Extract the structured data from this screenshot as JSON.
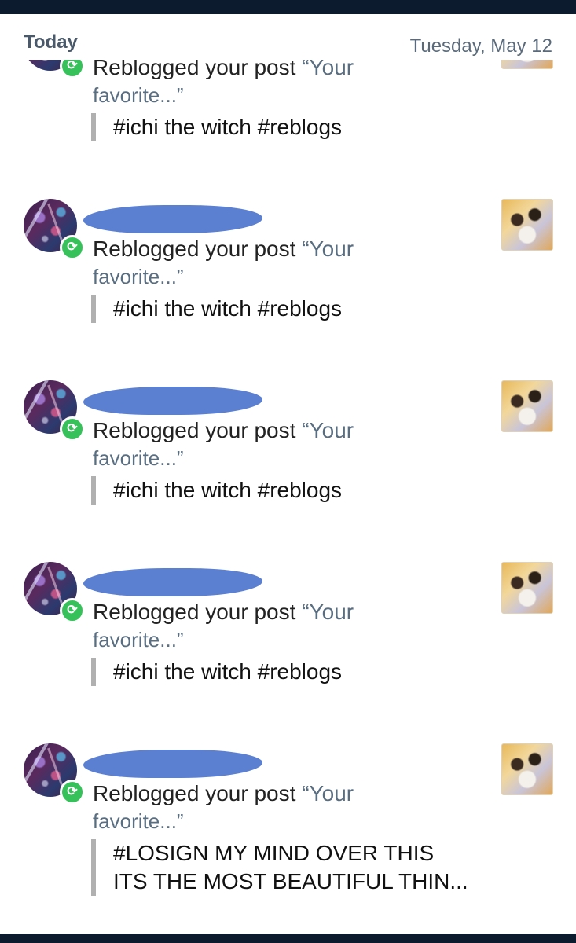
{
  "header": {
    "today_label": "Today",
    "date_label": "Tuesday, May 12"
  },
  "activity": [
    {
      "action": "Reblogged your post",
      "post_title_start": "“Your",
      "post_title_end": "favorite...”",
      "tags": "#ichi the witch #reblogs"
    },
    {
      "action": "Reblogged your post",
      "post_title_start": "“Your",
      "post_title_end": "favorite...”",
      "tags": "#ichi the witch #reblogs"
    },
    {
      "action": "Reblogged your post",
      "post_title_start": "“Your",
      "post_title_end": "favorite...”",
      "tags": "#ichi the witch #reblogs"
    },
    {
      "action": "Reblogged your post",
      "post_title_start": "“Your",
      "post_title_end": "favorite...”",
      "tags": "#ichi the witch #reblogs"
    },
    {
      "action": "Reblogged your post",
      "post_title_start": "“Your",
      "post_title_end": "favorite...”",
      "tags_line1": "#LOSIGN MY MIND OVER THIS",
      "tags_line2": "ITS THE MOST BEAUTIFUL THIN..."
    }
  ],
  "colors": {
    "system_bar": "#0d1b2e",
    "reblog_badge": "#37c15a",
    "redaction": "#5b7fd1"
  },
  "icons": {
    "reblog_badge": "reblog-icon"
  }
}
